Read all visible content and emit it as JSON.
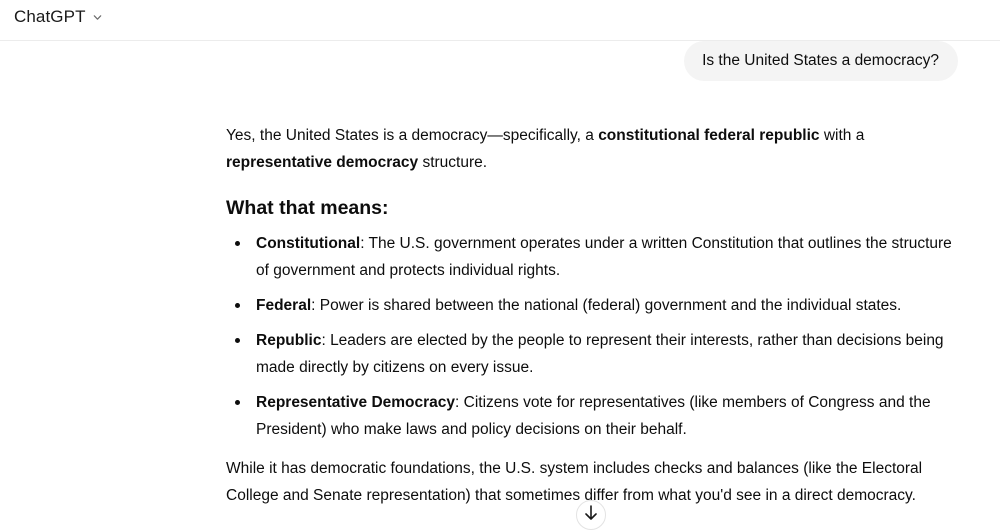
{
  "header": {
    "model_name": "ChatGPT",
    "model_dropdown_icon": "chevron-down-icon"
  },
  "conversation": {
    "user_message": "Is the United States a democracy?",
    "assistant": {
      "intro": {
        "t1": "Yes, the United States is a democracy—specifically, a ",
        "b1": "constitutional federal republic",
        "t2": " with a ",
        "b2": "representative democracy",
        "t3": " structure."
      },
      "heading": "What that means:",
      "bullets": [
        {
          "term": "Constitutional",
          "text": ": The U.S. government operates under a written Constitution that outlines the structure of government and protects individual rights."
        },
        {
          "term": "Federal",
          "text": ": Power is shared between the national (federal) government and the individual states."
        },
        {
          "term": "Republic",
          "text": ": Leaders are elected by the people to represent their interests, rather than decisions being made directly by citizens on every issue."
        },
        {
          "term": "Representative Democracy",
          "text": ": Citizens vote for representatives (like members of Congress and the President) who make laws and policy decisions on their behalf."
        }
      ],
      "closing": "While it has democratic foundations, the U.S. system includes checks and balances (like the Electoral College and Senate representation) that sometimes differ from what you'd see in a direct democracy."
    }
  },
  "controls": {
    "scroll_down_icon": "arrow-down-icon"
  }
}
